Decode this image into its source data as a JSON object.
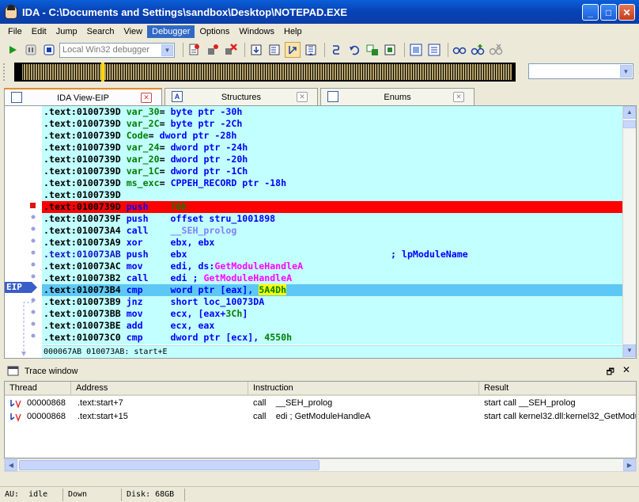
{
  "window": {
    "title": "IDA - C:\\Documents and Settings\\sandbox\\Desktop\\NOTEPAD.EXE"
  },
  "menu": [
    "File",
    "Edit",
    "Jump",
    "Search",
    "View",
    "Debugger",
    "Options",
    "Windows",
    "Help"
  ],
  "active_menu": "Debugger",
  "toolbar": {
    "debugger_select": "Local Win32 debugger"
  },
  "tabs": [
    {
      "label": "IDA View-EIP",
      "active": true
    },
    {
      "label": "Structures",
      "active": false
    },
    {
      "label": "Enums",
      "active": false
    }
  ],
  "code_lines": [
    {
      "addr": ".text:0100739D",
      "parts": [
        [
          "name",
          "var_30"
        ],
        [
          "plain",
          "= "
        ],
        [
          "op",
          "byte ptr -30h"
        ]
      ]
    },
    {
      "addr": ".text:0100739D",
      "parts": [
        [
          "name",
          "var_2C"
        ],
        [
          "plain",
          "= "
        ],
        [
          "op",
          "byte ptr -2Ch"
        ]
      ]
    },
    {
      "addr": ".text:0100739D",
      "parts": [
        [
          "name",
          "Code"
        ],
        [
          "plain",
          "= "
        ],
        [
          "op",
          "dword ptr -28h"
        ]
      ]
    },
    {
      "addr": ".text:0100739D",
      "parts": [
        [
          "name",
          "var_24"
        ],
        [
          "plain",
          "= "
        ],
        [
          "op",
          "dword ptr -24h"
        ]
      ]
    },
    {
      "addr": ".text:0100739D",
      "parts": [
        [
          "name",
          "var_20"
        ],
        [
          "plain",
          "= "
        ],
        [
          "op",
          "dword ptr -20h"
        ]
      ]
    },
    {
      "addr": ".text:0100739D",
      "parts": [
        [
          "name",
          "var_1C"
        ],
        [
          "plain",
          "= "
        ],
        [
          "op",
          "dword ptr -1Ch"
        ]
      ]
    },
    {
      "addr": ".text:0100739D",
      "parts": [
        [
          "name",
          "ms_exc"
        ],
        [
          "plain",
          "= "
        ],
        [
          "op",
          "CPPEH_RECORD ptr -18h"
        ]
      ]
    },
    {
      "addr": ".text:0100739D",
      "parts": []
    },
    {
      "addr": ".text:0100739D",
      "mnem": "push",
      "parts": [
        [
          "num",
          "70h"
        ]
      ],
      "style": "bp"
    },
    {
      "addr": ".text:0100739F",
      "mnem": "push",
      "parts": [
        [
          "op",
          "offset stru_1001898"
        ]
      ]
    },
    {
      "addr": ".text:010073A4",
      "mnem": "call",
      "parts": [
        [
          "xref",
          "__SEH_prolog"
        ]
      ]
    },
    {
      "addr": ".text:010073A9",
      "mnem": "xor",
      "parts": [
        [
          "op",
          "ebx, ebx"
        ]
      ]
    },
    {
      "addr": ".text:010073AB",
      "mnem": "push",
      "parts": [
        [
          "op",
          "ebx"
        ]
      ],
      "comment": "; lpModuleName",
      "addr_blue": true
    },
    {
      "addr": ".text:010073AC",
      "mnem": "mov",
      "parts": [
        [
          "op",
          "edi, ds:"
        ],
        [
          "imp",
          "GetModuleHandleA"
        ]
      ]
    },
    {
      "addr": ".text:010073B2",
      "mnem": "call",
      "parts": [
        [
          "op",
          "edi "
        ],
        [
          "cmt",
          "; "
        ],
        [
          "imp",
          "GetModuleHandleA"
        ]
      ]
    },
    {
      "addr": ".text:010073B4",
      "mnem": "cmp",
      "parts": [
        [
          "op",
          "word ptr [eax], "
        ],
        [
          "hl",
          "5A4Dh"
        ]
      ],
      "style": "eip"
    },
    {
      "addr": ".text:010073B9",
      "mnem": "jnz",
      "parts": [
        [
          "op",
          "short loc_10073DA"
        ]
      ]
    },
    {
      "addr": ".text:010073BB",
      "mnem": "mov",
      "parts": [
        [
          "op",
          "ecx, [eax+"
        ],
        [
          "num",
          "3Ch"
        ],
        [
          "op",
          "]"
        ]
      ]
    },
    {
      "addr": ".text:010073BE",
      "mnem": "add",
      "parts": [
        [
          "op",
          "ecx, eax"
        ]
      ]
    },
    {
      "addr": ".text:010073C0",
      "mnem": "cmp",
      "parts": [
        [
          "op",
          "dword ptr [ecx], "
        ],
        [
          "num",
          "4550h"
        ]
      ]
    }
  ],
  "code_status": "000067AB 010073AB: start+E",
  "eip_label": "EIP",
  "trace": {
    "title": "Trace window",
    "columns": [
      "Thread",
      "Address",
      "Instruction",
      "Result"
    ],
    "rows": [
      {
        "thread": "00000868",
        "address": ".text:start+7",
        "instruction": "call    __SEH_prolog",
        "result": "start call __SEH_prolog"
      },
      {
        "thread": "00000868",
        "address": ".text:start+15",
        "instruction": "call    edi ; GetModuleHandleA",
        "result": "start call kernel32.dll:kernel32_GetModu"
      }
    ]
  },
  "statusbar": {
    "au_label": "AU:",
    "au_state": "idle",
    "direction": "Down",
    "disk": "Disk: 68GB"
  }
}
